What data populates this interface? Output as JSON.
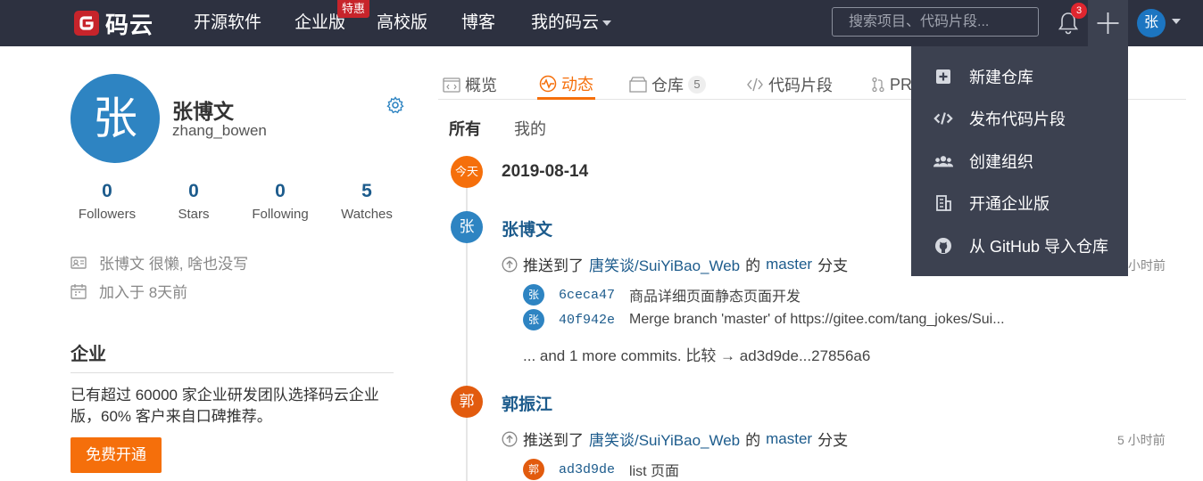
{
  "nav": {
    "logo_text": "码云",
    "items": [
      "开源软件",
      "企业版",
      "高校版",
      "博客",
      "我的码云"
    ],
    "promo_badge": "特惠",
    "search_placeholder": "搜索项目、代码片段...",
    "notification_count": "3",
    "avatar_char": "张"
  },
  "dropdown": {
    "items": [
      {
        "label": "新建仓库",
        "icon": "plus-square-icon"
      },
      {
        "label": "发布代码片段",
        "icon": "code-icon"
      },
      {
        "label": "创建组织",
        "icon": "users-icon"
      },
      {
        "label": "开通企业版",
        "icon": "building-icon"
      },
      {
        "label": "从 GitHub 导入仓库",
        "icon": "github-icon"
      }
    ]
  },
  "profile": {
    "avatar_char": "张",
    "name": "张博文",
    "handle": "zhang_bowen",
    "stats": [
      {
        "num": "0",
        "label": "Followers"
      },
      {
        "num": "0",
        "label": "Stars"
      },
      {
        "num": "0",
        "label": "Following"
      },
      {
        "num": "5",
        "label": "Watches"
      }
    ],
    "bio": "张博文 很懒, 啥也没写",
    "joined": "加入于 8天前"
  },
  "enterprise": {
    "title": "企业",
    "desc": "已有超过 60000 家企业研发团队选择码云企业版，60% 客户来自口碑推荐。",
    "button": "免费开通"
  },
  "tabs": [
    {
      "label": "概览"
    },
    {
      "label": "动态"
    },
    {
      "label": "仓库",
      "count": "5"
    },
    {
      "label": "代码片段"
    },
    {
      "label": "PR"
    }
  ],
  "filters": [
    "所有",
    "我的"
  ],
  "timeline": {
    "today_label": "今天",
    "date": "2019-08-14",
    "events": [
      {
        "avatar_char": "张",
        "actor": "张博文",
        "action_prefix": "推送到了",
        "repo": "唐笑谈/SuiYiBao_Web",
        "of": "的",
        "branch": "master",
        "suffix": "分支",
        "time": "小时前",
        "commits": [
          {
            "avatar_char": "张",
            "sha": "6ceca47",
            "message": "商品详细页面静态页面开发"
          },
          {
            "avatar_char": "张",
            "sha": "40f942e",
            "message": "Merge branch 'master' of https://gitee.com/tang_jokes/Sui..."
          }
        ],
        "more": "... and 1 more commits. 比较 → ad3d9de...27856a6"
      },
      {
        "avatar_char": "郭",
        "actor": "郭振江",
        "action_prefix": "推送到了",
        "repo": "唐笑谈/SuiYiBao_Web",
        "of": "的",
        "branch": "master",
        "suffix": "分支",
        "time": "5 小时前",
        "commits": [
          {
            "avatar_char": "郭",
            "sha": "ad3d9de",
            "message": "list 页面"
          }
        ]
      }
    ]
  },
  "colors": {
    "nav_bg": "#2d3140",
    "accent": "#f56f0b",
    "link": "#1c5b8c",
    "avatar_blue": "#2e84c2",
    "avatar_orange": "#e25b0e"
  }
}
